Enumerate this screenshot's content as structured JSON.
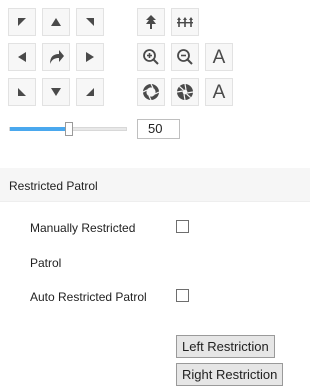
{
  "ptz": {
    "direction_icons": [
      "up-left-arrow-icon",
      "up-arrow-icon",
      "up-right-arrow-icon",
      "left-arrow-icon",
      "auto-pan-icon",
      "right-arrow-icon",
      "down-left-arrow-icon",
      "down-arrow-icon",
      "down-right-arrow-icon"
    ],
    "tool_icons": [
      "focus-near-icon",
      "focus-far-icon",
      "zoom-in-icon",
      "zoom-out-icon",
      "iris-open-icon",
      "iris-close-icon"
    ],
    "auto_focus_label": "A",
    "auto_iris_label": "A",
    "speed": {
      "value": "50",
      "level_fraction": 0.5
    }
  },
  "restricted_patrol": {
    "section_title": "Restricted Patrol",
    "manual_label_line1": "Manually Restricted",
    "manual_label_line2": "Patrol",
    "manual_checked": false,
    "auto_label": "Auto Restricted Patrol",
    "auto_checked": false,
    "left_restriction_button": "Left Restriction",
    "right_restriction_button": "Right Restriction"
  },
  "colors": {
    "accent": "#4aa8ee",
    "icon": "#4a4a4a",
    "panel_bg": "#f6f6f6"
  }
}
